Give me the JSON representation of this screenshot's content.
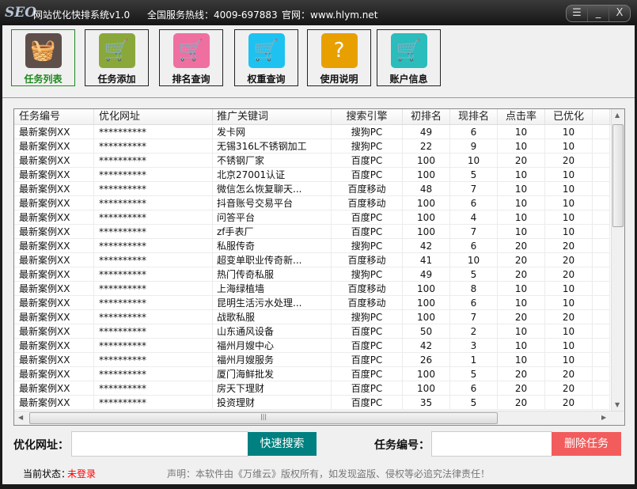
{
  "titlebar": {
    "logo": "SEO",
    "title": "网站优化快排系统v1.0",
    "hotline": "全国服务热线：4009-697883",
    "website": "官网：www.hlym.net",
    "menu_icon": "menu-icon",
    "minimize": "_",
    "close": "X"
  },
  "toolbar": [
    {
      "label": "任务列表",
      "icon": "basket-icon",
      "color": "#5e4f4a",
      "active": true
    },
    {
      "label": "任务添加",
      "icon": "cart-icon",
      "color": "#8aa83a"
    },
    {
      "label": "排名查询",
      "icon": "cart-icon",
      "color": "#ef6fa0"
    },
    {
      "label": "权重查询",
      "icon": "cart-minus-icon",
      "color": "#1ec2f0"
    },
    {
      "label": "使用说明",
      "icon": "question-icon",
      "color": "#e8a000"
    },
    {
      "label": "账户信息",
      "icon": "cart-list-icon",
      "color": "#2bbcbc"
    }
  ],
  "table": {
    "headers": [
      "任务编号",
      "优化网址",
      "推广关键词",
      "搜索引擎",
      "初排名",
      "现排名",
      "点击率",
      "已优化"
    ],
    "rows": [
      [
        "最新案例XX",
        "**********",
        "发卡网",
        "搜狗PC",
        "49",
        "6",
        "10",
        "10"
      ],
      [
        "最新案例XX",
        "**********",
        "无锡316L不锈钢加工",
        "搜狗PC",
        "22",
        "9",
        "10",
        "10"
      ],
      [
        "最新案例XX",
        "**********",
        "不锈钢厂家",
        "百度PC",
        "100",
        "10",
        "20",
        "20"
      ],
      [
        "最新案例XX",
        "**********",
        "北京27001认证",
        "百度PC",
        "100",
        "5",
        "10",
        "10"
      ],
      [
        "最新案例XX",
        "**********",
        "微信怎么恢复聊天...",
        "百度移动",
        "48",
        "7",
        "10",
        "10"
      ],
      [
        "最新案例XX",
        "**********",
        "抖音账号交易平台",
        "百度移动",
        "100",
        "6",
        "10",
        "10"
      ],
      [
        "最新案例XX",
        "**********",
        "问答平台",
        "百度PC",
        "100",
        "4",
        "10",
        "10"
      ],
      [
        "最新案例XX",
        "**********",
        "zf手表厂",
        "百度PC",
        "100",
        "7",
        "10",
        "10"
      ],
      [
        "最新案例XX",
        "**********",
        "私服传奇",
        "搜狗PC",
        "42",
        "6",
        "20",
        "20"
      ],
      [
        "最新案例XX",
        "**********",
        "超变单职业传奇新...",
        "百度移动",
        "41",
        "10",
        "20",
        "20"
      ],
      [
        "最新案例XX",
        "**********",
        "热门传奇私服",
        "搜狗PC",
        "49",
        "5",
        "20",
        "20"
      ],
      [
        "最新案例XX",
        "**********",
        "上海绿植墙",
        "百度移动",
        "100",
        "8",
        "10",
        "10"
      ],
      [
        "最新案例XX",
        "**********",
        "昆明生活污水处理...",
        "百度移动",
        "100",
        "6",
        "10",
        "10"
      ],
      [
        "最新案例XX",
        "**********",
        "战歌私服",
        "搜狗PC",
        "100",
        "7",
        "20",
        "20"
      ],
      [
        "最新案例XX",
        "**********",
        "山东通风设备",
        "百度PC",
        "50",
        "2",
        "10",
        "10"
      ],
      [
        "最新案例XX",
        "**********",
        "福州月嫂中心",
        "百度PC",
        "42",
        "3",
        "10",
        "10"
      ],
      [
        "最新案例XX",
        "**********",
        "福州月嫂服务",
        "百度PC",
        "26",
        "1",
        "10",
        "10"
      ],
      [
        "最新案例XX",
        "**********",
        "厦门海鲜批发",
        "百度PC",
        "100",
        "5",
        "20",
        "20"
      ],
      [
        "最新案例XX",
        "**********",
        "房天下理财",
        "百度PC",
        "100",
        "6",
        "20",
        "20"
      ],
      [
        "最新案例XX",
        "**********",
        "投资理财",
        "百度PC",
        "35",
        "5",
        "20",
        "20"
      ]
    ]
  },
  "search": {
    "url_label": "优化网址：",
    "url_value": "",
    "search_button": "快速搜索",
    "task_label": "任务编号：",
    "task_value": "",
    "delete_button": "删除任务"
  },
  "status": {
    "label": "当前状态：",
    "value": "未登录",
    "notice": "声明：本软件由《万维云》版权所有，如发现盗版、侵权等必追究法律责任！"
  },
  "colors": {
    "search_button": "#008080",
    "delete_button": "#f25c5c",
    "status_value": "#ff0000",
    "active_tab": "#1e8a1e"
  }
}
